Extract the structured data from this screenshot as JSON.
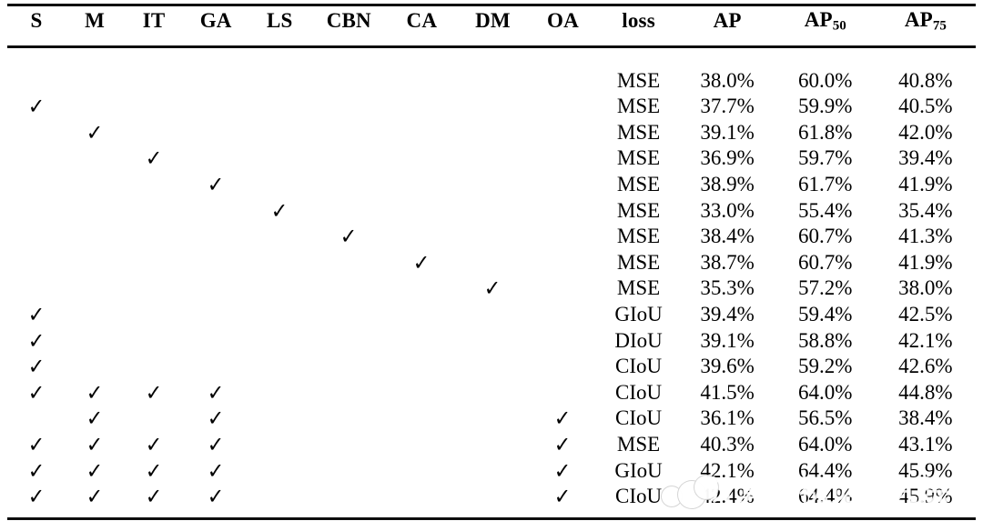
{
  "table": {
    "columns": [
      {
        "key": "S",
        "label": "S"
      },
      {
        "key": "M",
        "label": "M"
      },
      {
        "key": "IT",
        "label": "IT"
      },
      {
        "key": "GA",
        "label": "GA"
      },
      {
        "key": "LS",
        "label": "LS"
      },
      {
        "key": "CBN",
        "label": "CBN"
      },
      {
        "key": "CA",
        "label": "CA"
      },
      {
        "key": "DM",
        "label": "DM"
      },
      {
        "key": "OA",
        "label": "OA"
      },
      {
        "key": "loss",
        "label": "loss"
      },
      {
        "key": "AP",
        "label": "AP"
      },
      {
        "key": "AP50",
        "label": "AP",
        "sub": "50"
      },
      {
        "key": "AP75",
        "label": "AP",
        "sub": "75"
      }
    ],
    "check_glyph": "✓",
    "rows": [
      {
        "S": "",
        "M": "",
        "IT": "",
        "GA": "",
        "LS": "",
        "CBN": "",
        "CA": "",
        "DM": "",
        "OA": "",
        "loss": "MSE",
        "AP": "38.0%",
        "AP50": "60.0%",
        "AP75": "40.8%",
        "bold": {
          "AP": false,
          "AP50": false,
          "AP75": false
        }
      },
      {
        "S": "✓",
        "M": "",
        "IT": "",
        "GA": "",
        "LS": "",
        "CBN": "",
        "CA": "",
        "DM": "",
        "OA": "",
        "loss": "MSE",
        "AP": "37.7%",
        "AP50": "59.9%",
        "AP75": "40.5%",
        "bold": {
          "AP": false,
          "AP50": false,
          "AP75": false
        }
      },
      {
        "S": "",
        "M": "✓",
        "IT": "",
        "GA": "",
        "LS": "",
        "CBN": "",
        "CA": "",
        "DM": "",
        "OA": "",
        "loss": "MSE",
        "AP": "39.1%",
        "AP50": "61.8%",
        "AP75": "42.0%",
        "bold": {
          "AP": true,
          "AP50": true,
          "AP75": true
        }
      },
      {
        "S": "",
        "M": "",
        "IT": "✓",
        "GA": "",
        "LS": "",
        "CBN": "",
        "CA": "",
        "DM": "",
        "OA": "",
        "loss": "MSE",
        "AP": "36.9%",
        "AP50": "59.7%",
        "AP75": "39.4%",
        "bold": {
          "AP": false,
          "AP50": false,
          "AP75": false
        }
      },
      {
        "S": "",
        "M": "",
        "IT": "",
        "GA": "✓",
        "LS": "",
        "CBN": "",
        "CA": "",
        "DM": "",
        "OA": "",
        "loss": "MSE",
        "AP": "38.9%",
        "AP50": "61.7%",
        "AP75": "41.9%",
        "bold": {
          "AP": true,
          "AP50": true,
          "AP75": true
        }
      },
      {
        "S": "",
        "M": "",
        "IT": "",
        "GA": "",
        "LS": "✓",
        "CBN": "",
        "CA": "",
        "DM": "",
        "OA": "",
        "loss": "MSE",
        "AP": "33.0%",
        "AP50": "55.4%",
        "AP75": "35.4%",
        "bold": {
          "AP": false,
          "AP50": false,
          "AP75": false
        }
      },
      {
        "S": "",
        "M": "",
        "IT": "",
        "GA": "",
        "LS": "",
        "CBN": "✓",
        "CA": "",
        "DM": "",
        "OA": "",
        "loss": "MSE",
        "AP": "38.4%",
        "AP50": "60.7%",
        "AP75": "41.3%",
        "bold": {
          "AP": true,
          "AP50": true,
          "AP75": true
        }
      },
      {
        "S": "",
        "M": "",
        "IT": "",
        "GA": "",
        "LS": "",
        "CBN": "",
        "CA": "✓",
        "DM": "",
        "OA": "",
        "loss": "MSE",
        "AP": "38.7%",
        "AP50": "60.7%",
        "AP75": "41.9%",
        "bold": {
          "AP": true,
          "AP50": true,
          "AP75": true
        }
      },
      {
        "S": "",
        "M": "",
        "IT": "",
        "GA": "",
        "LS": "",
        "CBN": "",
        "CA": "",
        "DM": "✓",
        "OA": "",
        "loss": "MSE",
        "AP": "35.3%",
        "AP50": "57.2%",
        "AP75": "38.0%",
        "bold": {
          "AP": false,
          "AP50": false,
          "AP75": false
        }
      },
      {
        "S": "✓",
        "M": "",
        "IT": "",
        "GA": "",
        "LS": "",
        "CBN": "",
        "CA": "",
        "DM": "",
        "OA": "",
        "loss": "GIoU",
        "AP": "39.4%",
        "AP50": "59.4%",
        "AP75": "42.5%",
        "bold": {
          "AP": true,
          "AP50": false,
          "AP75": true
        }
      },
      {
        "S": "✓",
        "M": "",
        "IT": "",
        "GA": "",
        "LS": "",
        "CBN": "",
        "CA": "",
        "DM": "",
        "OA": "",
        "loss": "DIoU",
        "AP": "39.1%",
        "AP50": "58.8%",
        "AP75": "42.1%",
        "bold": {
          "AP": true,
          "AP50": false,
          "AP75": true
        }
      },
      {
        "S": "✓",
        "M": "",
        "IT": "",
        "GA": "",
        "LS": "",
        "CBN": "",
        "CA": "",
        "DM": "",
        "OA": "",
        "loss": "CIoU",
        "AP": "39.6%",
        "AP50": "59.2%",
        "AP75": "42.6%",
        "bold": {
          "AP": true,
          "AP50": false,
          "AP75": true
        }
      },
      {
        "S": "✓",
        "M": "✓",
        "IT": "✓",
        "GA": "✓",
        "LS": "",
        "CBN": "",
        "CA": "",
        "DM": "",
        "OA": "",
        "loss": "CIoU",
        "AP": "41.5%",
        "AP50": "64.0%",
        "AP75": "44.8%",
        "bold": {
          "AP": true,
          "AP50": true,
          "AP75": true
        }
      },
      {
        "S": "",
        "M": "✓",
        "IT": "",
        "GA": "✓",
        "LS": "",
        "CBN": "",
        "CA": "",
        "DM": "",
        "OA": "✓",
        "loss": "CIoU",
        "AP": "36.1%",
        "AP50": "56.5%",
        "AP75": "38.4%",
        "bold": {
          "AP": false,
          "AP50": false,
          "AP75": false
        }
      },
      {
        "S": "✓",
        "M": "✓",
        "IT": "✓",
        "GA": "✓",
        "LS": "",
        "CBN": "",
        "CA": "",
        "DM": "",
        "OA": "✓",
        "loss": "MSE",
        "AP": "40.3%",
        "AP50": "64.0%",
        "AP75": "43.1%",
        "bold": {
          "AP": true,
          "AP50": true,
          "AP75": true
        }
      },
      {
        "S": "✓",
        "M": "✓",
        "IT": "✓",
        "GA": "✓",
        "LS": "",
        "CBN": "",
        "CA": "",
        "DM": "",
        "OA": "✓",
        "loss": "GIoU",
        "AP": "42.1%",
        "AP50": "64.4%",
        "AP75": "45.9%",
        "bold": {
          "AP": true,
          "AP50": true,
          "AP75": true
        }
      },
      {
        "S": "✓",
        "M": "✓",
        "IT": "✓",
        "GA": "✓",
        "LS": "",
        "CBN": "",
        "CA": "",
        "DM": "",
        "OA": "✓",
        "loss": "CIoU",
        "AP": "42.4%",
        "AP50": "64.4%",
        "AP75": "45.9%",
        "bold": {
          "AP": true,
          "AP50": true,
          "AP75": true
        }
      }
    ]
  },
  "watermark": {
    "text": "计算机视觉研究院"
  }
}
